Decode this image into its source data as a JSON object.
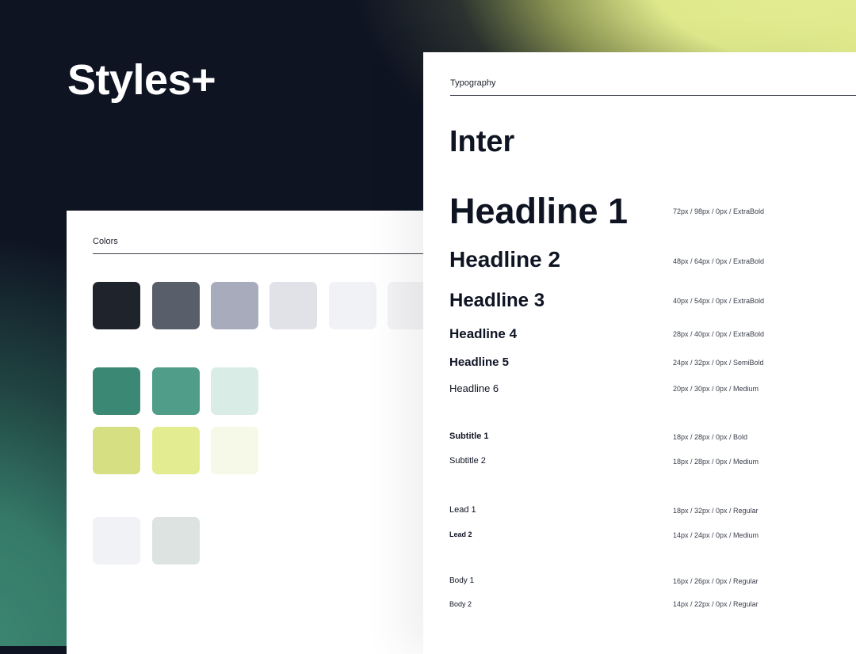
{
  "brand": {
    "title": "Styles+"
  },
  "colors": {
    "heading": "Colors",
    "neutrals": [
      "#1f232b",
      "#595e6b",
      "#a8abbb",
      "#e1e2e7",
      "#f1f2f5",
      "#f3f3f5"
    ],
    "greens": [
      "#3b8874",
      "#509d89",
      "#d9ece6"
    ],
    "yellows": [
      "#d6df82",
      "#e3ec91",
      "#f6f9e7"
    ],
    "grays": [
      "#f1f2f5",
      "#dde3e0"
    ]
  },
  "typography": {
    "heading": "Typography",
    "font_family": "Inter",
    "styles": [
      {
        "name": "Headline 1",
        "spec": "72px / 98px / 0px / ExtraBold"
      },
      {
        "name": "Headline 2",
        "spec": "48px / 64px / 0px / ExtraBold"
      },
      {
        "name": "Headline 3",
        "spec": "40px / 54px / 0px / ExtraBold"
      },
      {
        "name": "Headline 4",
        "spec": "28px / 40px / 0px / ExtraBold"
      },
      {
        "name": "Headline 5",
        "spec": "24px / 32px / 0px / SemiBold"
      },
      {
        "name": "Headline 6",
        "spec": "20px / 30px / 0px / Medium"
      },
      {
        "name": "Subtitle 1",
        "spec": "18px / 28px / 0px / Bold"
      },
      {
        "name": "Subtitle 2",
        "spec": "18px / 28px / 0px / Medium"
      },
      {
        "name": "Lead 1",
        "spec": "18px / 32px / 0px / Regular"
      },
      {
        "name": "Lead 2",
        "spec": "14px / 24px / 0px / Medium"
      },
      {
        "name": "Body 1",
        "spec": "16px / 26px / 0px / Regular"
      },
      {
        "name": "Body 2",
        "spec": "14px / 22px / 0px / Regular"
      }
    ]
  }
}
